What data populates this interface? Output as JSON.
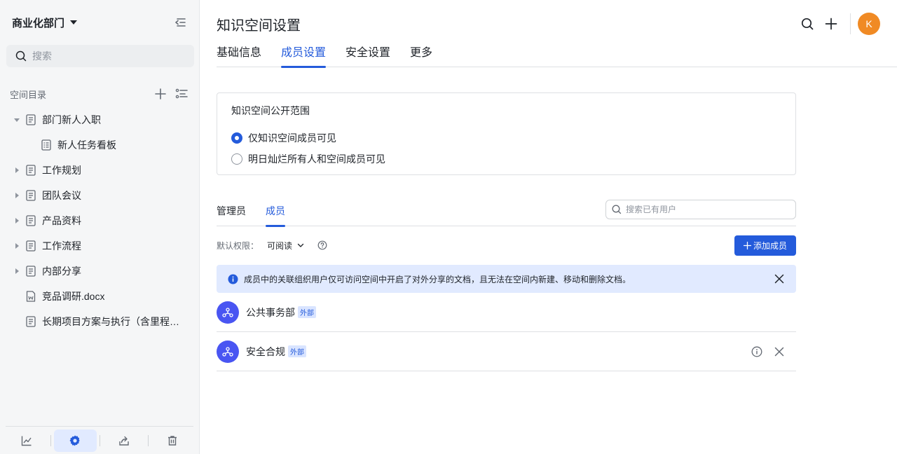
{
  "sidebar": {
    "workspace_name": "商业化部门",
    "search_placeholder": "搜索",
    "directory_label": "空间目录",
    "tree": [
      {
        "label": "部门新人入职",
        "expanded": true,
        "icon": "doc-icon"
      },
      {
        "label": "新人任务看板",
        "child": true,
        "icon": "board-icon"
      },
      {
        "label": "工作规划",
        "icon": "doc-icon"
      },
      {
        "label": "团队会议",
        "icon": "doc-icon"
      },
      {
        "label": "产品资料",
        "icon": "doc-icon"
      },
      {
        "label": "工作流程",
        "icon": "doc-icon"
      },
      {
        "label": "内部分享",
        "icon": "doc-icon"
      },
      {
        "label": "竞品调研.docx",
        "icon": "word-icon"
      },
      {
        "label": "长期项目方案与执行（含里程碑）",
        "icon": "doc-icon"
      }
    ],
    "bottom_icons": [
      "chart-icon",
      "settings-icon",
      "share-icon",
      "trash-icon"
    ]
  },
  "header": {
    "title": "知识空间设置",
    "avatar_letter": "K",
    "avatar_color": "#f08a24"
  },
  "tabs": [
    "基础信息",
    "成员设置",
    "安全设置",
    "更多"
  ],
  "active_tab": "成员设置",
  "scope": {
    "title": "知识空间公开范围",
    "options": [
      "仅知识空间成员可见",
      "明日灿烂所有人和空间成员可见"
    ],
    "selected": 0
  },
  "member_tabs": [
    "管理员",
    "成员"
  ],
  "member_search_placeholder": "搜索已有用户",
  "permission": {
    "label": "默认权限：",
    "value": "可阅读"
  },
  "add_member_label": "添加成员",
  "notice_text": "成员中的关联组织用户仅可访问空间中开启了对外分享的文档，且无法在空间内新建、移动和删除文档。",
  "members": [
    {
      "name": "公共事务部",
      "tag": "外部"
    },
    {
      "name": "安全合规",
      "tag": "外部"
    }
  ],
  "colors": {
    "accent": "#245bdb",
    "org_avatar": "#4955f2",
    "notice_bg": "#e1eaff"
  }
}
